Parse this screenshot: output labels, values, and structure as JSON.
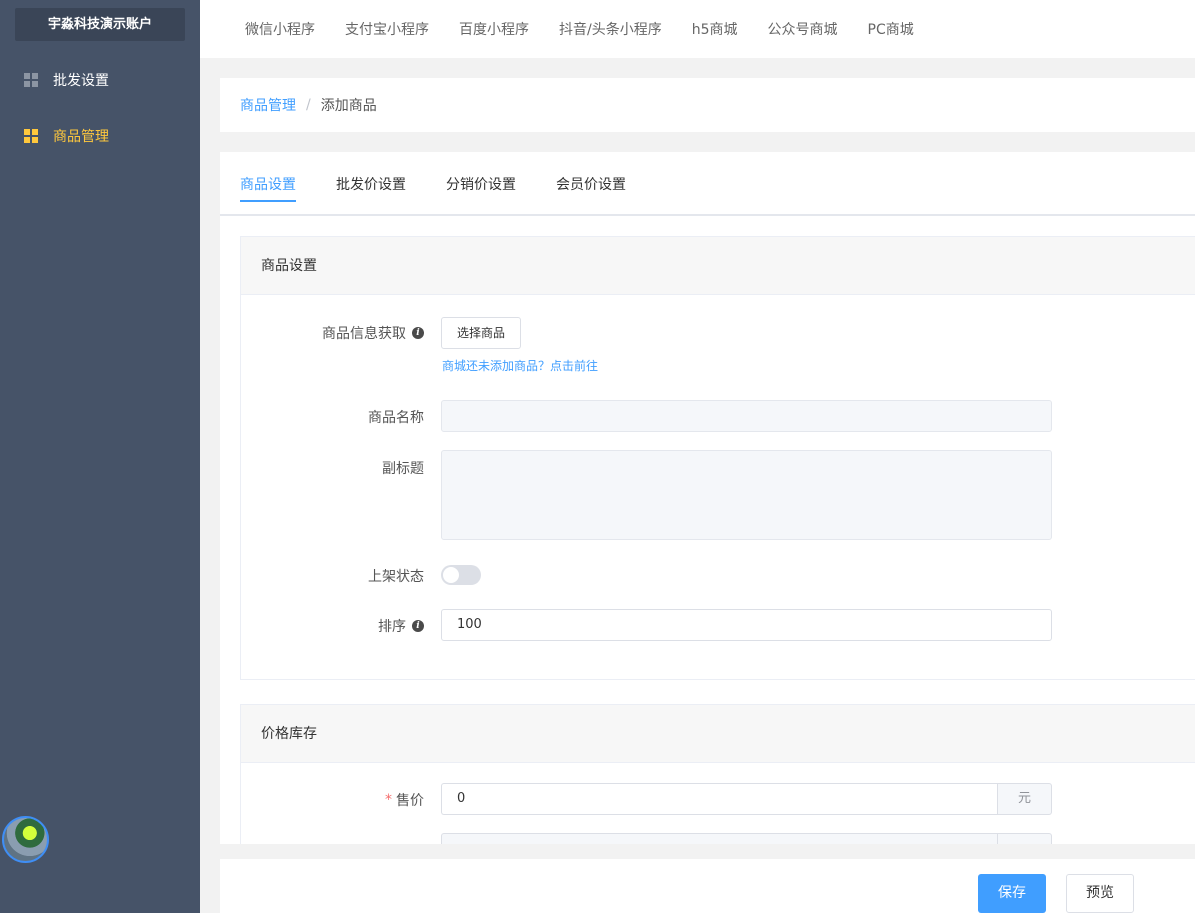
{
  "sidebar": {
    "account": "宇淼科技演示账户",
    "items": [
      {
        "label": "批发设置",
        "icon": "grid-icon",
        "active": false
      },
      {
        "label": "商品管理",
        "icon": "grid-icon",
        "active": true
      }
    ],
    "active_color": "#ffc83d"
  },
  "topnav": {
    "items": [
      "微信小程序",
      "支付宝小程序",
      "百度小程序",
      "抖音/头条小程序",
      "h5商城",
      "公众号商城",
      "PC商城"
    ]
  },
  "breadcrumb": {
    "parent": "商品管理",
    "separator": "/",
    "current": "添加商品"
  },
  "tabs": [
    {
      "label": "商品设置",
      "active": true
    },
    {
      "label": "批发价设置",
      "active": false
    },
    {
      "label": "分销价设置",
      "active": false
    },
    {
      "label": "会员价设置",
      "active": false
    }
  ],
  "goods_settings": {
    "title": "商品设置",
    "info_label": "商品信息获取",
    "select_button": "选择商品",
    "hint_link": "商城还未添加商品？点击前往",
    "name_label": "商品名称",
    "name_value": "",
    "subtitle_label": "副标题",
    "status_label": "上架状态",
    "status_on": false,
    "sort_label": "排序",
    "sort_value": "100"
  },
  "price_stock": {
    "title": "价格库存",
    "price_label": "售价",
    "price_value": "0",
    "price_unit": "元"
  },
  "footer": {
    "save": "保存",
    "preview": "预览"
  },
  "colors": {
    "primary": "#409eff",
    "sidebar_bg": "#465368",
    "required": "#f56c6c"
  }
}
